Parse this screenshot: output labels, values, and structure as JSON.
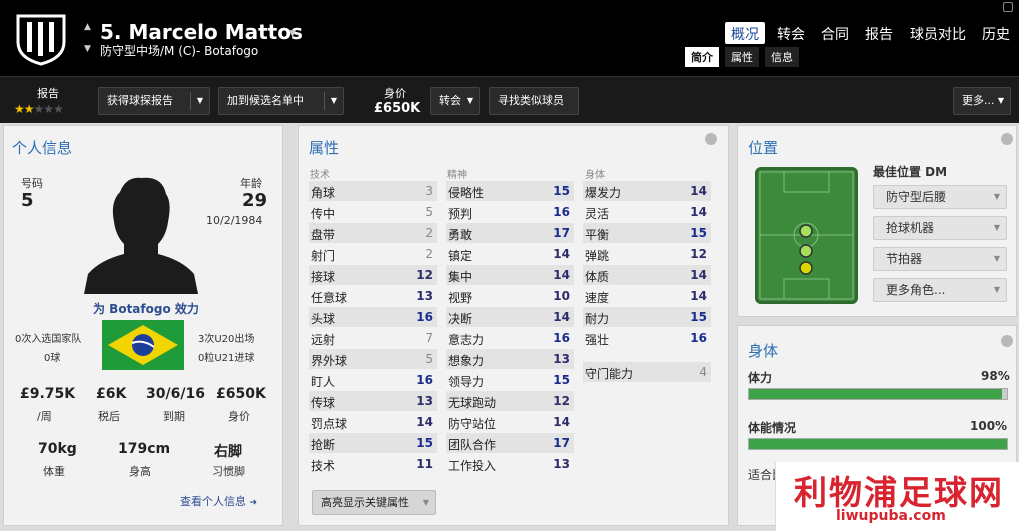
{
  "header": {
    "number_name": "5. Marcelo Mattos",
    "position_club": "防守型中场/M (C)- Botafogo",
    "nav_tabs": [
      "概况",
      "转会",
      "合同",
      "报告",
      "球员对比",
      "历史"
    ],
    "sub_tabs": [
      "简介",
      "属性",
      "信息"
    ]
  },
  "toolbar": {
    "report_label": "报告",
    "stars": 2,
    "stars_max": 5,
    "scout_btn": "获得球探报告",
    "shortlist_btn": "加到候选名单中",
    "value_label": "身价",
    "value": "£650K",
    "transfer_btn": "转会",
    "similar_btn": "寻找类似球员",
    "more_btn": "更多..."
  },
  "personal": {
    "title": "个人信息",
    "number_label": "号码",
    "number": "5",
    "age_label": "年龄",
    "age": "29",
    "dob": "10/2/1984",
    "plays_for": "为 Botafogo 效力",
    "caps_left1": "0次入选国家队",
    "caps_left2": "0球",
    "caps_right1": "3次U20出场",
    "caps_right2": "0粒U21进球",
    "wage": "£9.75K",
    "wage_label": "/周",
    "net": "£6K",
    "net_label": "税后",
    "expiry": "30/6/16",
    "expiry_label": "到期",
    "pvalue": "£650K",
    "pvalue_label": "身价",
    "weight": "70kg",
    "weight_label": "体重",
    "height": "179cm",
    "height_label": "身高",
    "foot": "右脚",
    "foot_label": "习惯脚",
    "view_link": "查看个人信息"
  },
  "attributes": {
    "title": "属性",
    "col_tech": "技术",
    "col_mental": "精神",
    "col_phys": "身体",
    "highlight_btn": "高亮显示关键属性",
    "technical": [
      [
        "角球",
        "3"
      ],
      [
        "传中",
        "5"
      ],
      [
        "盘带",
        "2"
      ],
      [
        "射门",
        "2"
      ],
      [
        "接球",
        "12"
      ],
      [
        "任意球",
        "13"
      ],
      [
        "头球",
        "16"
      ],
      [
        "远射",
        "7"
      ],
      [
        "界外球",
        "5"
      ],
      [
        "盯人",
        "16"
      ],
      [
        "传球",
        "13"
      ],
      [
        "罚点球",
        "14"
      ],
      [
        "抢断",
        "15"
      ],
      [
        "技术",
        "11"
      ]
    ],
    "mental": [
      [
        "侵略性",
        "15"
      ],
      [
        "预判",
        "16"
      ],
      [
        "勇敢",
        "17"
      ],
      [
        "镇定",
        "14"
      ],
      [
        "集中",
        "14"
      ],
      [
        "视野",
        "10"
      ],
      [
        "决断",
        "14"
      ],
      [
        "意志力",
        "16"
      ],
      [
        "想象力",
        "13"
      ],
      [
        "领导力",
        "15"
      ],
      [
        "无球跑动",
        "12"
      ],
      [
        "防守站位",
        "14"
      ],
      [
        "团队合作",
        "17"
      ],
      [
        "工作投入",
        "13"
      ]
    ],
    "physical": [
      [
        "爆发力",
        "14"
      ],
      [
        "灵活",
        "14"
      ],
      [
        "平衡",
        "15"
      ],
      [
        "弹跳",
        "12"
      ],
      [
        "体质",
        "14"
      ],
      [
        "速度",
        "14"
      ],
      [
        "耐力",
        "15"
      ],
      [
        "强壮",
        "16"
      ]
    ],
    "gk": [
      [
        "守门能力",
        "4"
      ]
    ]
  },
  "position": {
    "title": "位置",
    "best_label": "最佳位置 DM",
    "roles": [
      "防守型后腰",
      "抢球机器",
      "节拍器",
      "更多角色..."
    ]
  },
  "physical_panel": {
    "title": "身体",
    "stamina_label": "体力",
    "stamina": "98%",
    "stamina_frac": 0.98,
    "fitness_label": "体能情况",
    "fitness": "100%",
    "fitness_frac": 1.0,
    "suitable_label": "适合比"
  },
  "watermark": {
    "cn": "利物浦足球网",
    "url": "liwupuba.com"
  },
  "colors": {
    "accent": "#2d6fb4",
    "bar_fill": "#3fa34a"
  }
}
